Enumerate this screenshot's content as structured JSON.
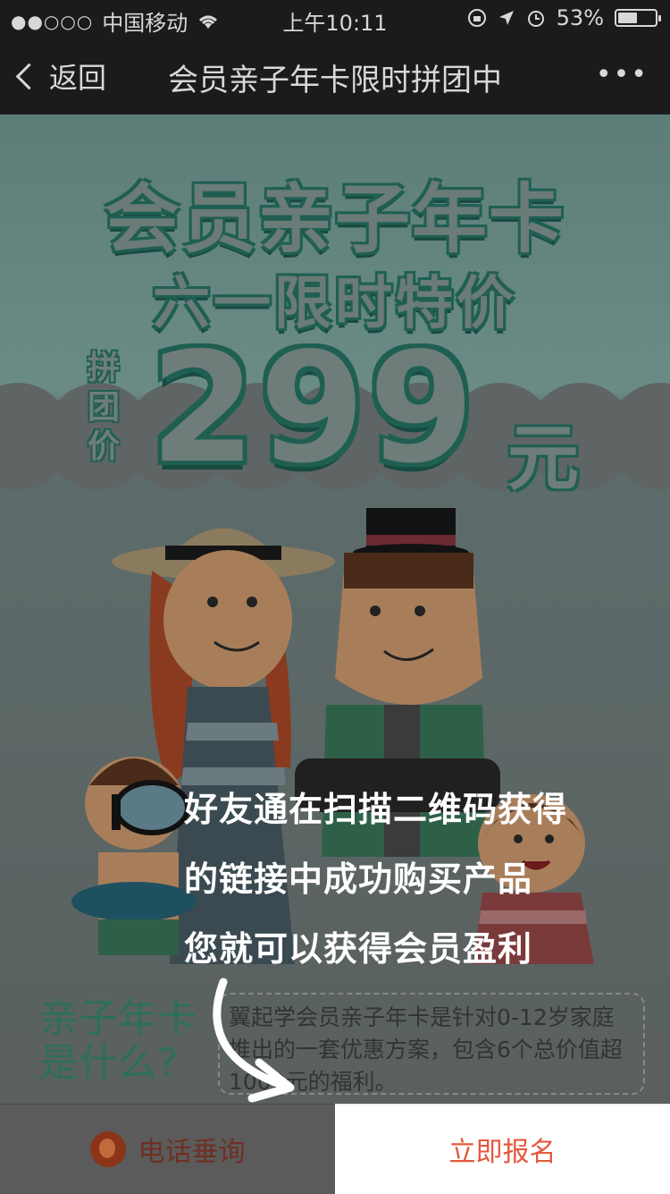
{
  "status_bar": {
    "signal": "●●○○○",
    "carrier": "中国移动",
    "time": "上午10:11",
    "battery": "53%",
    "battery_level": 0.53
  },
  "nav": {
    "back_label": "返回",
    "title": "会员亲子年卡限时拼团中",
    "more": "•••"
  },
  "poster": {
    "headline": "会员亲子年卡",
    "subheadline": "六一限时特价",
    "price_tag": "拼团价",
    "price": "299",
    "price_unit": "元"
  },
  "overlay": {
    "line1": "好友通在扫描二维码获得",
    "line2": "的链接中成功购买产品",
    "line3": "您就可以获得会员盈利"
  },
  "info": {
    "question_line1": "亲子年卡",
    "question_line2": "是什么?",
    "description": "翼起学会员亲子年卡是针对0-12岁家庭推出的一套优惠方案，包含6个总价值超1000元的福利。"
  },
  "bottom": {
    "phone_label": "电话垂询",
    "signup_label": "立即报名"
  },
  "colors": {
    "accent": "#e4583e",
    "poster_green": "#2e6f5a",
    "nav_bg": "#1b1b1b"
  }
}
